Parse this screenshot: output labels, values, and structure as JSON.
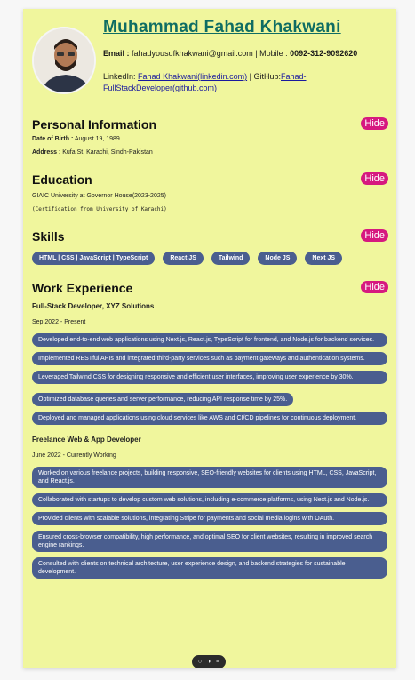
{
  "header": {
    "name": "Muhammad Fahad Khakwani",
    "email_label": "Email :",
    "email": "fahadyousufkhakwani@gmail.com",
    "separator": "|",
    "mobile_label": "Mobile :",
    "mobile": "0092-312-9092620",
    "linkedin_label": "LinkedIn:",
    "linkedin_text": "Fahad Khakwani(linkedin.com)",
    "github_label": "GitHub:",
    "github_text": "Fahad-FullStackDeveloper(github.com)"
  },
  "personal": {
    "title": "Personal Information",
    "hide": "Hide",
    "dob_label": "Date of Birth :",
    "dob": "August 19, 1989",
    "address_label": "Address :",
    "address": "Kufa St, Karachi, Sindh-Pakistan"
  },
  "education": {
    "title": "Education",
    "hide": "Hide",
    "school": "GIAIC University at Governor House(2023-2025)",
    "cert": "(Certification from University of Karachi)"
  },
  "skills": {
    "title": "Skills",
    "hide": "Hide",
    "items": [
      "HTML | CSS | JavaScript | TypeScript",
      "React JS",
      "Tailwind",
      "Node JS",
      "Next JS"
    ]
  },
  "work": {
    "title": "Work Experience",
    "hide": "Hide",
    "jobs": [
      {
        "title": "Full-Stack Developer, XYZ Solutions",
        "date": "Sep 2022 - Present",
        "points": [
          "Developed end-to-end web applications using Next.js, React.js, TypeScript for frontend, and Node.js for backend services.",
          "Implemented RESTful APIs and integrated third-party services such as payment gateways and authentication systems.",
          "Leveraged Tailwind CSS for designing responsive and efficient user interfaces, improving user experience by 30%.",
          "Optimized database queries and server performance, reducing API response time by 25%.",
          "Deployed and managed applications using cloud services like AWS and CI/CD pipelines for continuous deployment."
        ]
      },
      {
        "title": "Freelance Web & App Developer",
        "date": "June 2022 - Currently Working",
        "points": [
          "Worked on various freelance projects, building responsive, SEO-friendly websites for clients using HTML, CSS, JavaScript, and React.js.",
          "Collaborated with startups to develop custom web solutions, including e-commerce platforms, using Next.js and Node.js.",
          "Provided clients with scalable solutions, integrating Stripe for payments and social media logins with OAuth.",
          "Ensured cross-browser compatibility, high performance, and optimal SEO for client websites, resulting in improved search engine rankings.",
          "Consulted with clients on technical architecture, user experience design, and backend strategies for sustainable development."
        ]
      }
    ]
  },
  "colors": {
    "accent": "#d6197f",
    "name": "#0f6d63",
    "pill": "#4a5e8f",
    "card": "#f0f69d"
  }
}
